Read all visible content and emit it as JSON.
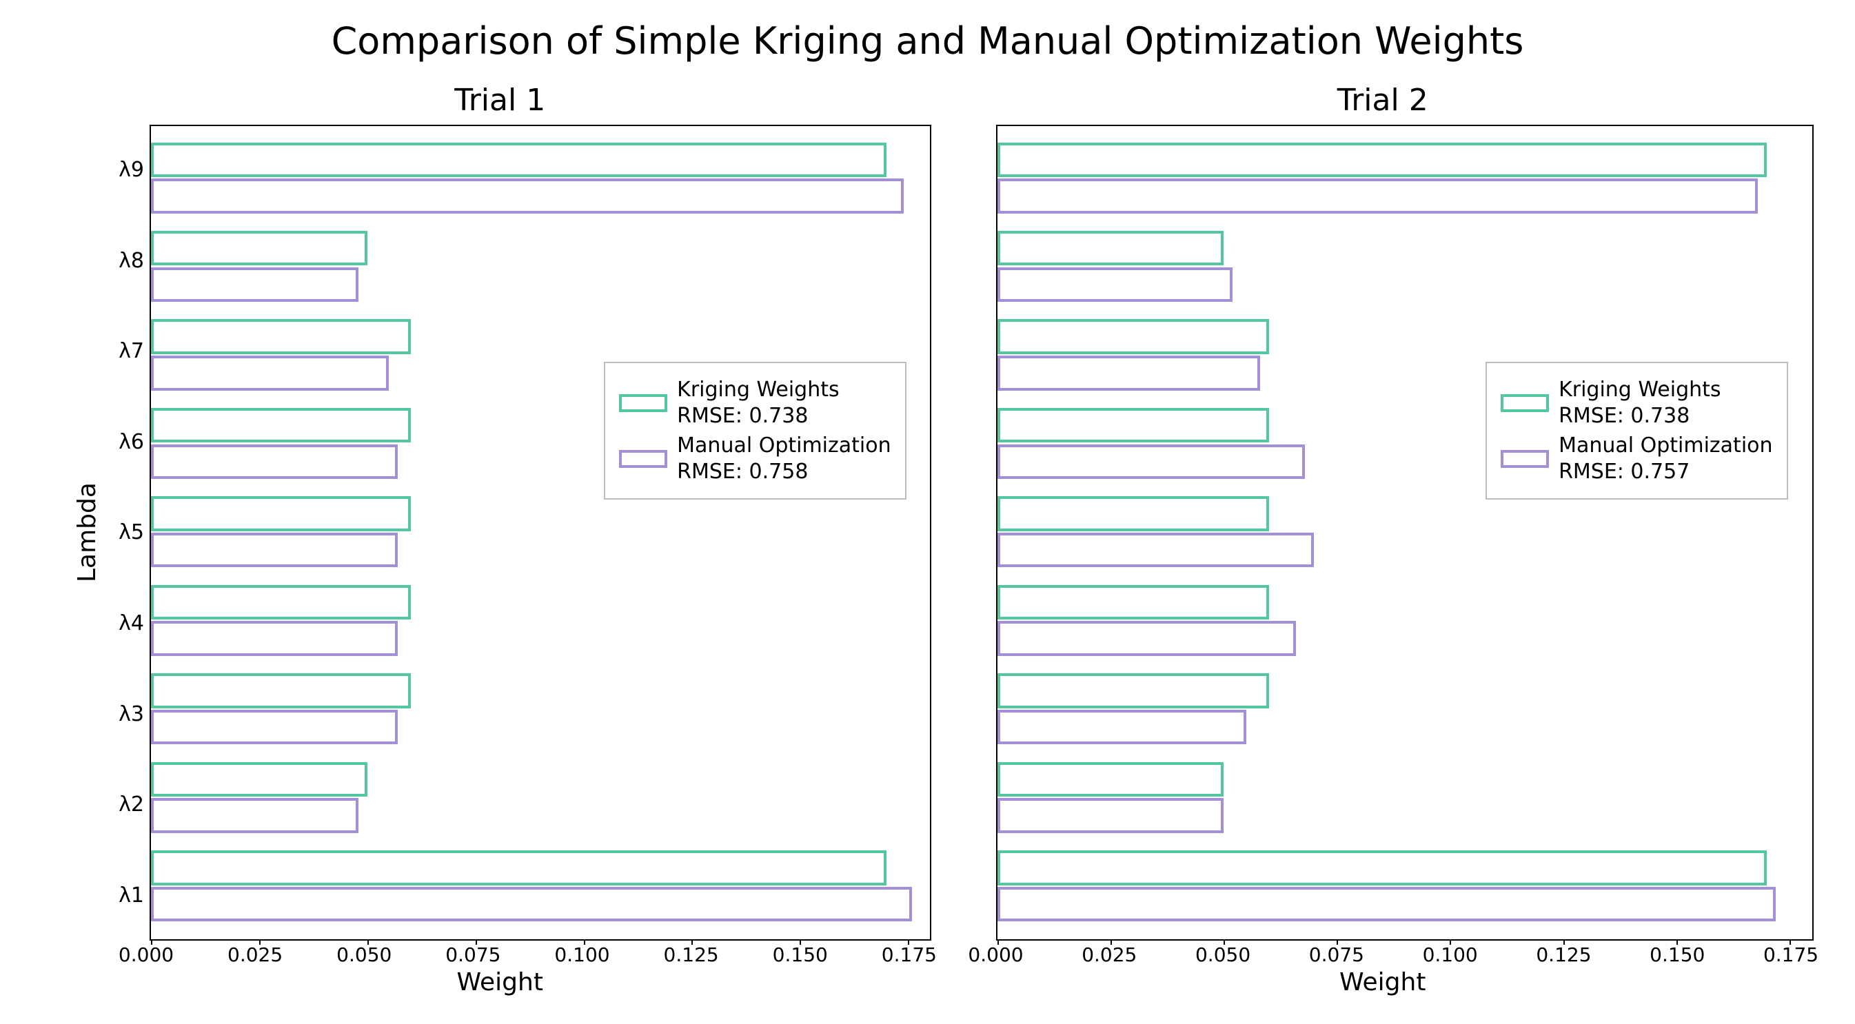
{
  "suptitle": "Comparison of Simple Kriging and Manual Optimization Weights",
  "ylabel": "Lambda",
  "xlabel": "Weight",
  "yticks": [
    "λ1",
    "λ2",
    "λ3",
    "λ4",
    "λ5",
    "λ6",
    "λ7",
    "λ8",
    "λ9"
  ],
  "xticks": [
    {
      "v": 0.0,
      "label": "0.000"
    },
    {
      "v": 0.025,
      "label": "0.025"
    },
    {
      "v": 0.05,
      "label": "0.050"
    },
    {
      "v": 0.075,
      "label": "0.075"
    },
    {
      "v": 0.1,
      "label": "0.100"
    },
    {
      "v": 0.125,
      "label": "0.125"
    },
    {
      "v": 0.15,
      "label": "0.150"
    },
    {
      "v": 0.175,
      "label": "0.175"
    }
  ],
  "xmax": 0.18,
  "series_labels": {
    "kriging_prefix": "Kriging Weights",
    "manual_prefix": "Manual Optimization",
    "rmse_prefix": "RMSE: "
  },
  "colors": {
    "kriging": "#52c7a0",
    "manual": "#a38fd6"
  },
  "chart_data": [
    {
      "title": "Trial 1",
      "type": "bar",
      "orientation": "horizontal",
      "categories": [
        "λ1",
        "λ2",
        "λ3",
        "λ4",
        "λ5",
        "λ6",
        "λ7",
        "λ8",
        "λ9"
      ],
      "xlim": [
        0,
        0.18
      ],
      "xlabel": "Weight",
      "ylabel": "Lambda",
      "series": [
        {
          "name": "Kriging Weights",
          "rmse": 0.738,
          "values": [
            0.17,
            0.05,
            0.06,
            0.06,
            0.06,
            0.06,
            0.06,
            0.05,
            0.17
          ]
        },
        {
          "name": "Manual Optimization",
          "rmse": 0.758,
          "values": [
            0.176,
            0.048,
            0.057,
            0.057,
            0.057,
            0.057,
            0.055,
            0.048,
            0.174
          ]
        }
      ]
    },
    {
      "title": "Trial 2",
      "type": "bar",
      "orientation": "horizontal",
      "categories": [
        "λ1",
        "λ2",
        "λ3",
        "λ4",
        "λ5",
        "λ6",
        "λ7",
        "λ8",
        "λ9"
      ],
      "xlim": [
        0,
        0.18
      ],
      "xlabel": "Weight",
      "ylabel": "Lambda",
      "series": [
        {
          "name": "Kriging Weights",
          "rmse": 0.738,
          "values": [
            0.17,
            0.05,
            0.06,
            0.06,
            0.06,
            0.06,
            0.06,
            0.05,
            0.17
          ]
        },
        {
          "name": "Manual Optimization",
          "rmse": 0.757,
          "values": [
            0.172,
            0.05,
            0.055,
            0.066,
            0.07,
            0.068,
            0.058,
            0.052,
            0.168
          ]
        }
      ]
    }
  ]
}
